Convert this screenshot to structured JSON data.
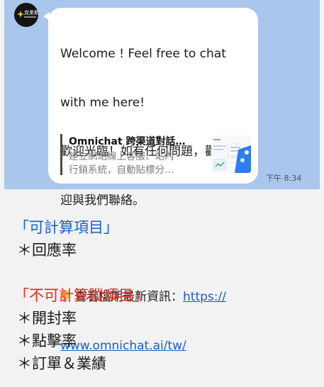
{
  "chat": {
    "avatar": {
      "name": "克里斯",
      "icon": "brand-logo-icon"
    },
    "message": {
      "line1": "Welcome ! Feel free to chat",
      "line2": "with me here!",
      "line3": "歡迎光臨！如有任何問題，歡",
      "line4": "迎與我們聯絡。",
      "info_icon": "lightbulb-icon",
      "info_label": "查看檔期最新資訊：",
      "link_part1": "https://",
      "link_part2": "www.omnichat.ai/tw/"
    },
    "preview": {
      "title": "Omnichat 跨渠道對話…",
      "desc_line1": "建立網站線上客服、站內",
      "desc_line2": "行銷系統，自動貼標分…",
      "thumb_icon": "website-preview-thumbnail"
    },
    "timestamp": "下午 8:34"
  },
  "notes": {
    "heading1": "「可計算項目」",
    "items1": [
      "＊回應率"
    ],
    "heading2": "「不可計算蹤項目」",
    "items2": [
      "＊開封率",
      "＊點擊率",
      "＊訂單＆業績"
    ]
  },
  "colors": {
    "chat_background": "#a9c6ec",
    "bubble": "#ffffff",
    "link": "#1a5fc7",
    "heading_blue": "#1a5fc7",
    "heading_red": "#e8291c"
  }
}
